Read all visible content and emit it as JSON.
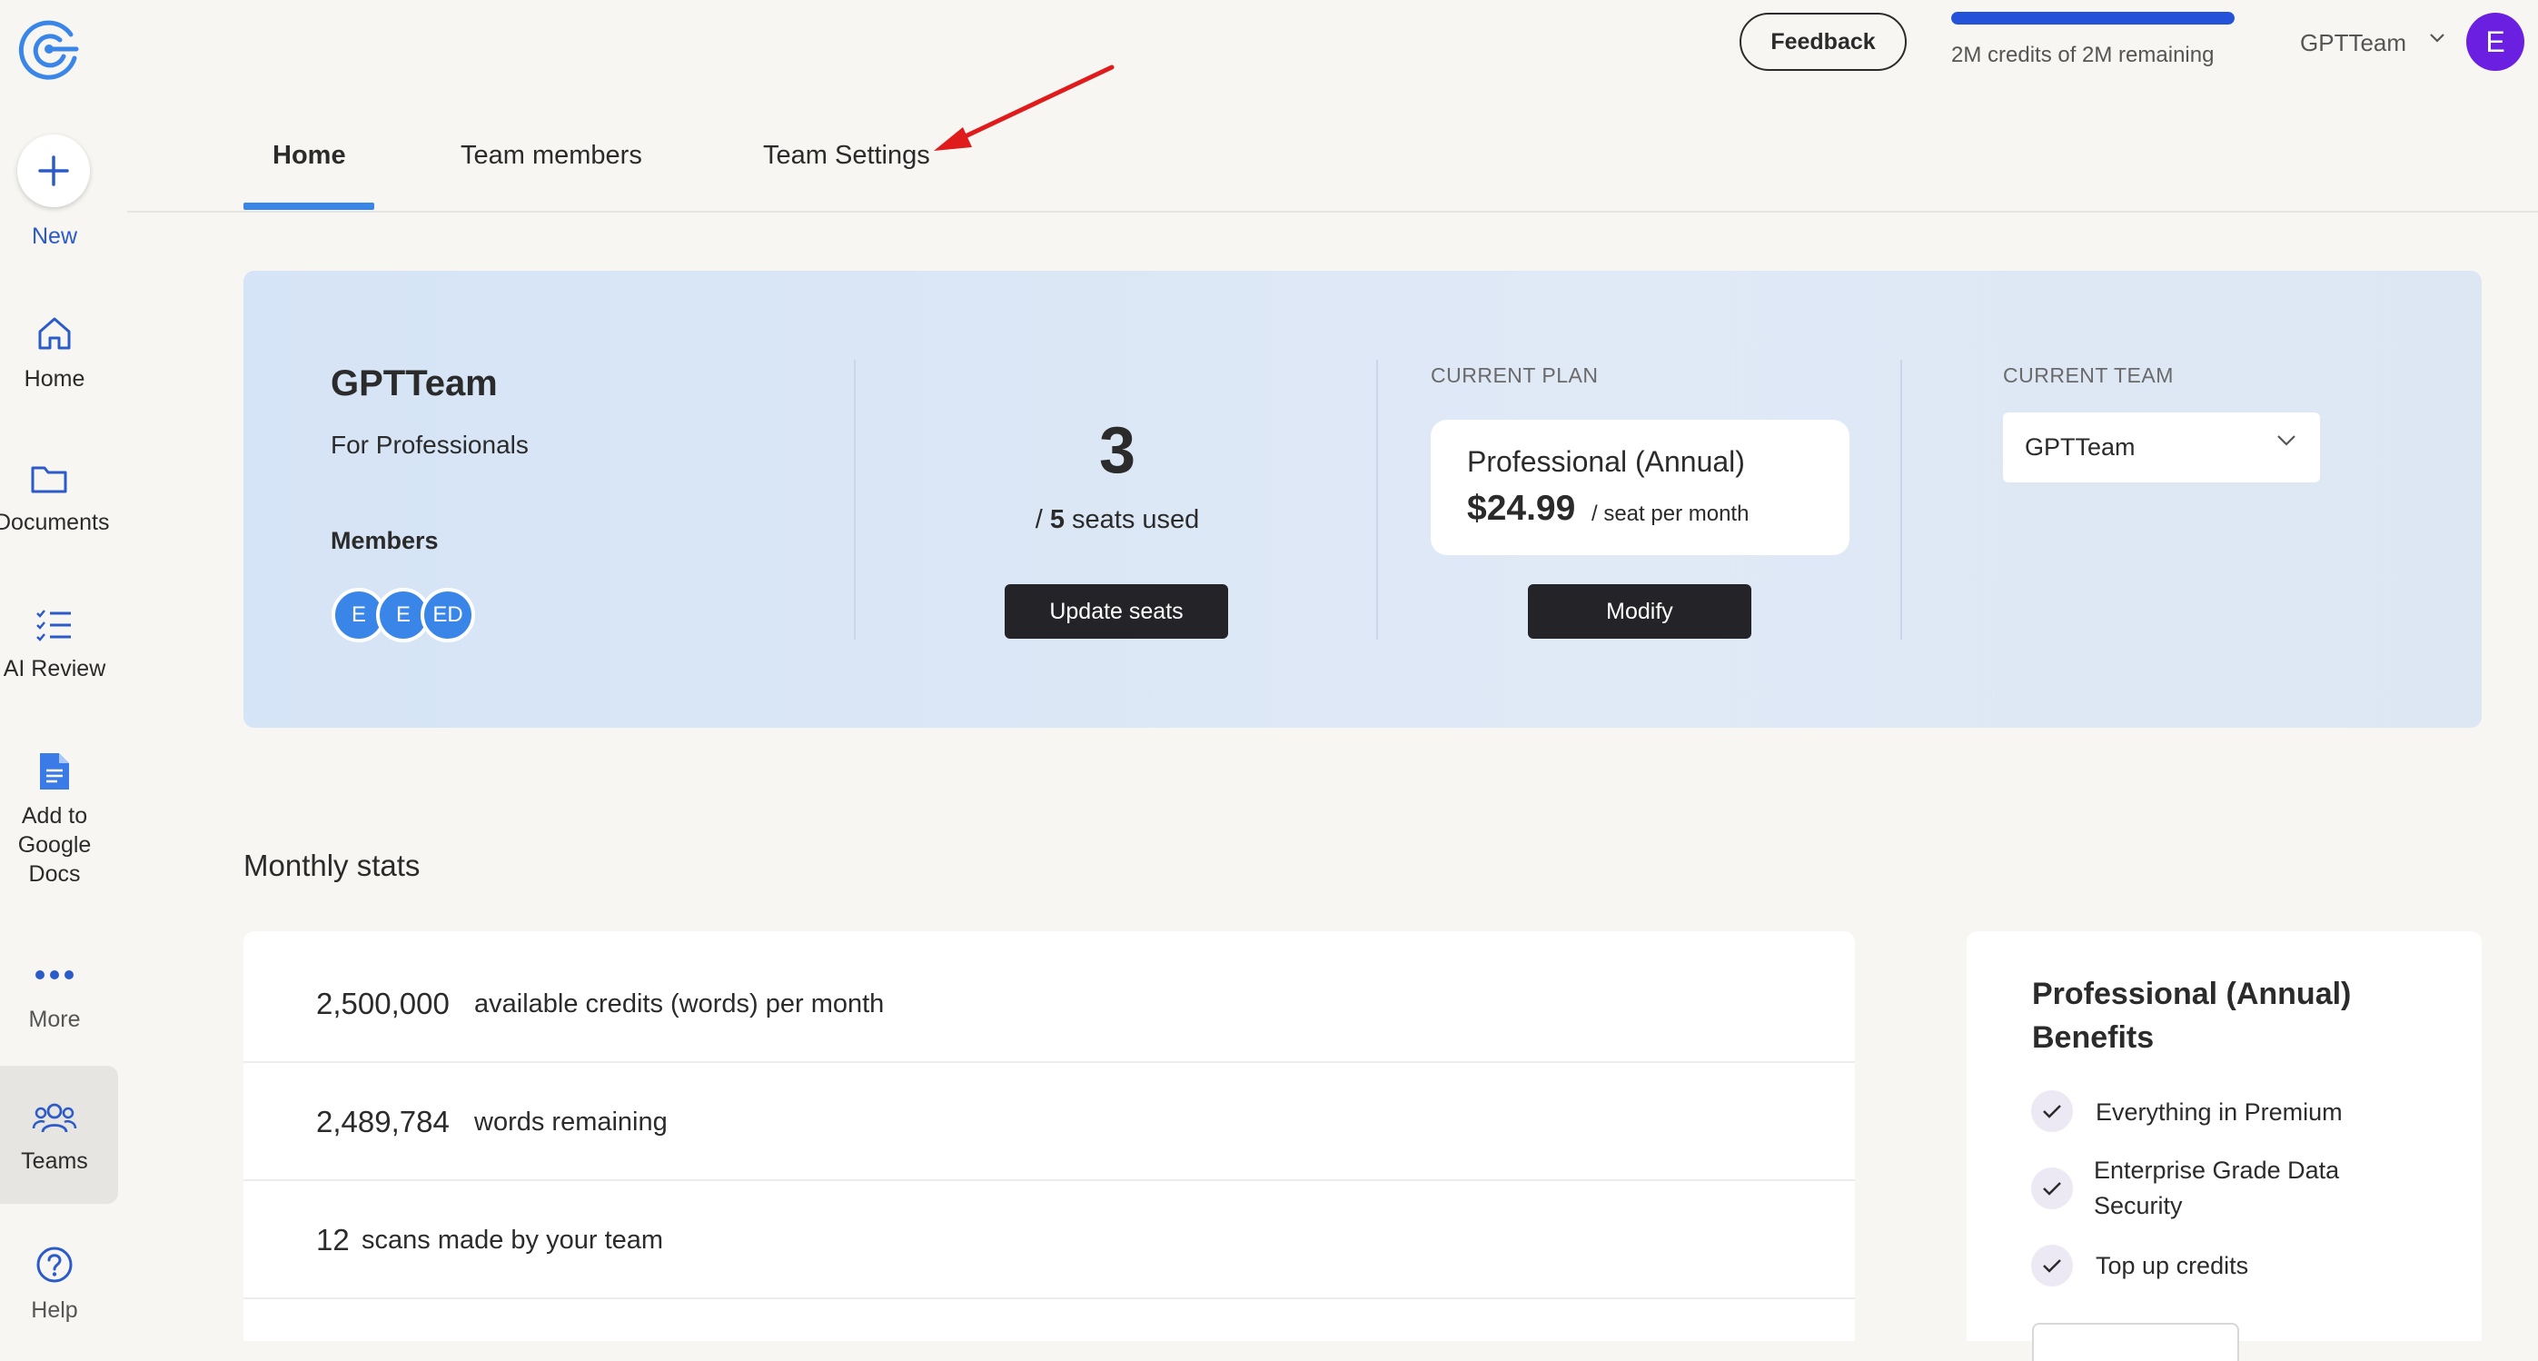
{
  "sidebar": {
    "new_label": "New",
    "items": [
      {
        "label": "Home",
        "icon": "home-icon"
      },
      {
        "label": "Documents",
        "icon": "folder-icon"
      },
      {
        "label": "AI Review",
        "icon": "checklist-icon"
      },
      {
        "label": "Add to Google Docs",
        "label_lines": [
          "Add to",
          "Google",
          "Docs"
        ],
        "icon": "google-docs-icon"
      },
      {
        "label": "More",
        "icon": "more-dots-icon"
      },
      {
        "label": "Teams",
        "icon": "teams-icon",
        "active": true
      },
      {
        "label": "Help",
        "icon": "help-icon"
      }
    ]
  },
  "header": {
    "feedback_label": "Feedback",
    "credits_text": "2M credits of 2M remaining",
    "credits_fraction": 1.0,
    "team_name": "GPTTeam",
    "avatar_initial": "E"
  },
  "tabs": [
    {
      "label": "Home",
      "active": true
    },
    {
      "label": "Team members",
      "active": false
    },
    {
      "label": "Team Settings",
      "active": false
    }
  ],
  "team_card": {
    "name": "GPTTeam",
    "subtitle": "For Professionals",
    "members_label": "Members",
    "members": [
      "E",
      "E",
      "ED"
    ],
    "seats_used": "3",
    "seats_total": "5",
    "seats_suffix": "seats used",
    "seats_prefix": "/",
    "update_seats_label": "Update seats",
    "current_plan_caption": "CURRENT PLAN",
    "plan_name": "Professional (Annual)",
    "plan_price": "$24.99",
    "plan_unit": "/ seat per month",
    "modify_label": "Modify",
    "current_team_caption": "CURRENT TEAM",
    "current_team_value": "GPTTeam"
  },
  "stats": {
    "title": "Monthly stats",
    "rows": [
      {
        "value": "2,500,000",
        "desc": "available credits (words) per month"
      },
      {
        "value": "2,489,784",
        "desc": "words remaining"
      },
      {
        "value": "12",
        "desc": "scans made by your team"
      }
    ]
  },
  "benefits": {
    "title": "Professional (Annual) Benefits",
    "items": [
      {
        "text": "Everything in Premium"
      },
      {
        "text": "Enterprise Grade Data Security"
      },
      {
        "text": "Top up credits"
      }
    ]
  },
  "colors": {
    "accent": "#3a86e8",
    "brand_blue": "#2452d8",
    "avatar": "#6b1fe0",
    "annotation_arrow": "#e01b1b",
    "dark_button": "#232328"
  }
}
